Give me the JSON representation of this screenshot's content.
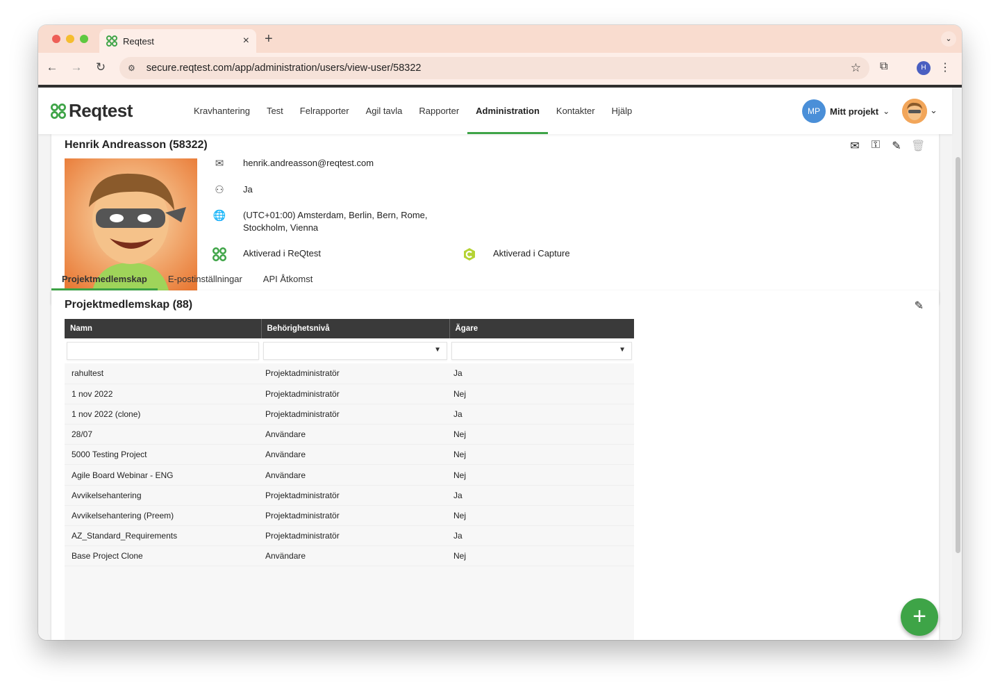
{
  "browser": {
    "tab_title": "Reqtest",
    "tab_close": "×",
    "new_tab": "+",
    "url": "secure.reqtest.com/app/administration/users/view-user/58322",
    "profile_initial": "H"
  },
  "app": {
    "logo_text": "Reqtest",
    "nav": [
      "Kravhantering",
      "Test",
      "Felrapporter",
      "Agil tavla",
      "Rapporter",
      "Administration",
      "Kontakter",
      "Hjälp"
    ],
    "active_nav": "Administration",
    "project_initials": "MP",
    "project_name": "Mitt projekt"
  },
  "user": {
    "title": "Henrik Andreasson (58322)",
    "email": "henrik.andreasson@reqtest.com",
    "admin": "Ja",
    "timezone": "(UTC+01:00) Amsterdam, Berlin, Bern, Rome, Stockholm, Vienna",
    "reqtest_status": "Aktiverad i ReQtest",
    "capture_status": "Aktiverad i Capture"
  },
  "tabs": [
    "Projektmedlemskap",
    "E-postinställningar",
    "API Åtkomst"
  ],
  "membership": {
    "title": "Projektmedlemskap (88)",
    "columns": [
      "Namn",
      "Behörighetsnivå",
      "Ägare"
    ],
    "rows": [
      [
        "rahultest",
        "Projektadministratör",
        "Ja"
      ],
      [
        "1 nov 2022",
        "Projektadministratör",
        "Nej"
      ],
      [
        "1 nov 2022 (clone)",
        "Projektadministratör",
        "Ja"
      ],
      [
        "28/07",
        "Användare",
        "Nej"
      ],
      [
        "5000 Testing Project",
        "Användare",
        "Nej"
      ],
      [
        "Agile Board Webinar - ENG",
        "Användare",
        "Nej"
      ],
      [
        "Avvikelsehantering",
        "Projektadministratör",
        "Ja"
      ],
      [
        "Avvikelsehantering (Preem)",
        "Projektadministratör",
        "Nej"
      ],
      [
        "AZ_Standard_Requirements",
        "Projektadministratör",
        "Ja"
      ],
      [
        "Base Project Clone",
        "Användare",
        "Nej"
      ]
    ]
  },
  "colors": {
    "brand_green": "#3ea447",
    "header_dark": "#3a3a3a",
    "project_blue": "#4a8fd8",
    "tabbar": "#f9dccf"
  }
}
